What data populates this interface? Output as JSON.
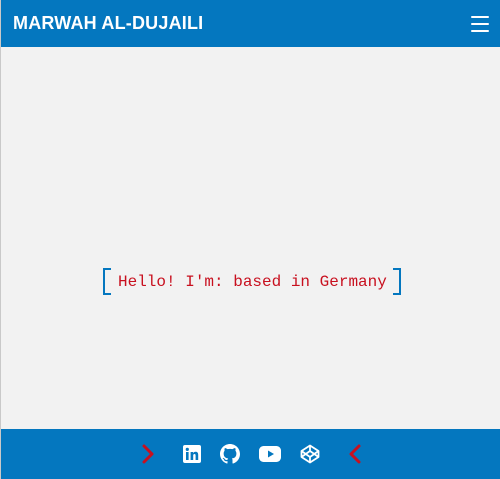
{
  "header": {
    "title": "MARWAH AL-DUJAILI",
    "menu_icon": "hamburger-menu-icon"
  },
  "main": {
    "tagline": "Hello! I'm: based in Germany"
  },
  "footer": {
    "icons": [
      "chevron-right-icon",
      "linkedin-icon",
      "github-icon",
      "youtube-icon",
      "codepen-icon",
      "chevron-left-icon"
    ]
  },
  "colors": {
    "primary": "#0477bf",
    "accent": "#c8101f",
    "background": "#f2f2f2",
    "text_light": "#ffffff"
  }
}
